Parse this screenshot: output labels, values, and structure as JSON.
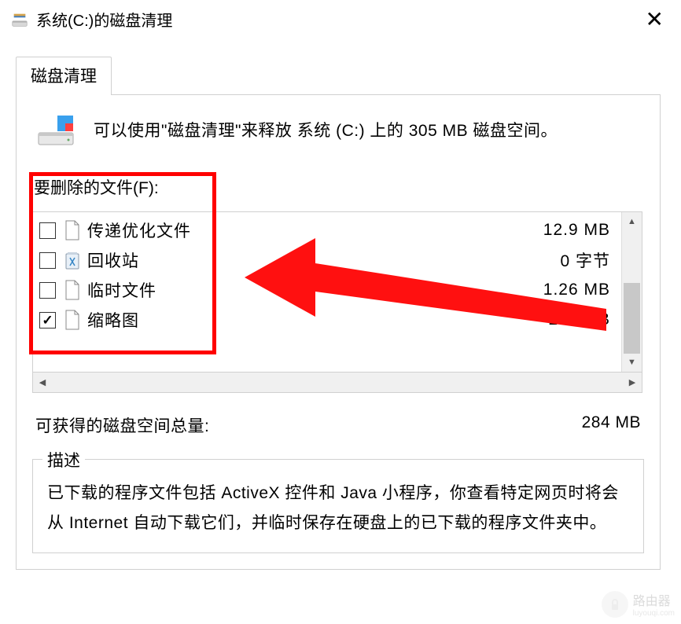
{
  "window": {
    "title": "系统(C:)的磁盘清理"
  },
  "tab": {
    "label": "磁盘清理"
  },
  "info": {
    "text": "可以使用\"磁盘清理\"来释放 系统 (C:) 上的 305 MB 磁盘空间。"
  },
  "files": {
    "label": "要删除的文件(F):",
    "items": [
      {
        "name": "传递优化文件",
        "size": "12.9 MB",
        "checked": false,
        "icon": "doc"
      },
      {
        "name": "回收站",
        "size": "0 字节",
        "checked": false,
        "icon": "recycle"
      },
      {
        "name": "临时文件",
        "size": "1.26 MB",
        "checked": false,
        "icon": "doc"
      },
      {
        "name": "缩略图",
        "size": "284 MB",
        "checked": true,
        "icon": "doc"
      }
    ]
  },
  "total": {
    "label": "可获得的磁盘空间总量:",
    "value": "284 MB"
  },
  "description": {
    "legend": "描述",
    "text": "已下载的程序文件包括 ActiveX 控件和 Java 小程序，你查看特定网页时将会从 Internet 自动下载它们，并临时保存在硬盘上的已下载的程序文件夹中。"
  },
  "watermark": {
    "text": "路由器"
  }
}
